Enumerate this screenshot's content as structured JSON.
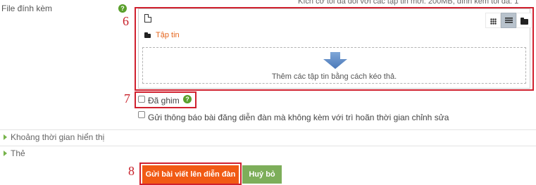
{
  "attachments": {
    "label": "File đính kèm",
    "help_icon": "question-circle-icon",
    "limit_text": "Kích cỡ tối đa đối với các tập tin mới: 200MB, đính kèm tối đa: 1",
    "toolbar": {
      "add_file_icon": "file-icon",
      "views": [
        {
          "name": "grid-view",
          "icon": "grid-icon",
          "active": false
        },
        {
          "name": "list-view",
          "icon": "list-icon",
          "active": true
        },
        {
          "name": "tree-view",
          "icon": "folder-icon",
          "active": false
        }
      ]
    },
    "folder_label": "Tập tin",
    "drop_text": "Thêm các tập tin bằng cách kéo thả."
  },
  "options": {
    "pinned_label": "Đã ghim",
    "notify_label": "Gửi thông báo bài đăng diễn đàn mà không kèm với trì hoãn thời gian chỉnh sửa"
  },
  "sections": [
    {
      "label": "Khoảng thời gian hiển thị"
    },
    {
      "label": "Thẻ"
    }
  ],
  "buttons": {
    "submit_label": "Gửi bài viết lên diễn đàn",
    "cancel_label": "Huỷ bỏ"
  },
  "annotations": {
    "n6": "6",
    "n7": "7",
    "n8": "8"
  },
  "colors": {
    "annotation_red": "#d0202e",
    "submit": "#f15a14",
    "cancel": "#7dae5a",
    "accent_orange": "#e5651d",
    "help_green": "#5aa02c"
  }
}
